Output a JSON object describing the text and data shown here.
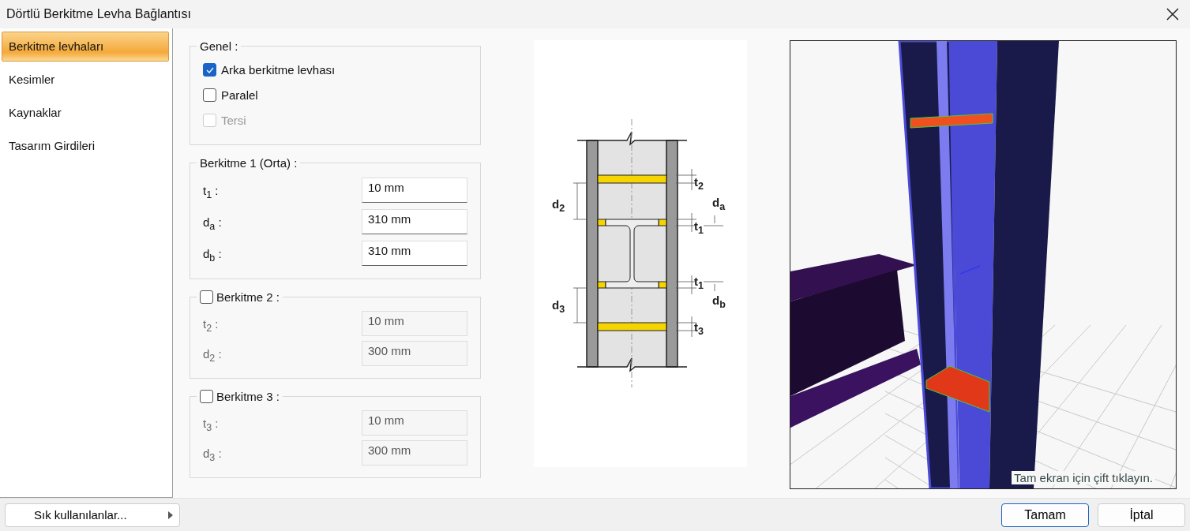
{
  "window": {
    "title": "Dörtlü Berkitme Levha Bağlantısı"
  },
  "sidebar": {
    "items": [
      {
        "label": "Berkitme levhaları",
        "selected": true
      },
      {
        "label": "Kesimler",
        "selected": false
      },
      {
        "label": "Kaynaklar",
        "selected": false
      },
      {
        "label": "Tasarım Girdileri",
        "selected": false
      }
    ]
  },
  "general": {
    "title": "Genel :",
    "options": [
      {
        "label": "Arka berkitme levhası",
        "checked": true,
        "disabled": false
      },
      {
        "label": "Paralel",
        "checked": false,
        "disabled": false
      },
      {
        "label": "Tersi",
        "checked": false,
        "disabled": true
      }
    ]
  },
  "groups": [
    {
      "kind": "plain",
      "title": "Berkitme 1 (Orta)  :",
      "fields": [
        {
          "label": "t$_{1}$ :",
          "value": "10 mm",
          "disabled": false
        },
        {
          "label": "d$_{a}$ :",
          "value": "310 mm",
          "disabled": false
        },
        {
          "label": "d$_{b}$ :",
          "value": "310 mm",
          "disabled": false
        }
      ]
    },
    {
      "kind": "checkbox",
      "title": "Berkitme 2 :",
      "checked": false,
      "fields": [
        {
          "label": "t$_{2}$ :",
          "value": "10 mm",
          "disabled": true
        },
        {
          "label": "d$_{2}$ :",
          "value": "300 mm",
          "disabled": true
        }
      ]
    },
    {
      "kind": "checkbox",
      "title": "Berkitme 3 :",
      "checked": false,
      "fields": [
        {
          "label": "t$_{3}$ :",
          "value": "10 mm",
          "disabled": true
        },
        {
          "label": "d$_{3}$ :",
          "value": "300 mm",
          "disabled": true
        }
      ]
    }
  ],
  "diagram": {
    "labels": [
      "t$_{2}$",
      "d$_{2}$",
      "d$_{a}$",
      "t$_{1}$",
      "t$_{1}$",
      "d$_{b}$",
      "d$_{3}$",
      "t$_{3}$"
    ]
  },
  "viewer": {
    "hint": "Tam ekran için çift tıklayın."
  },
  "footer": {
    "favorites": "Sık kullanılanlar...",
    "buttons": [
      {
        "label": "Tamam",
        "default": true
      },
      {
        "label": "İptal",
        "default": false
      }
    ]
  }
}
